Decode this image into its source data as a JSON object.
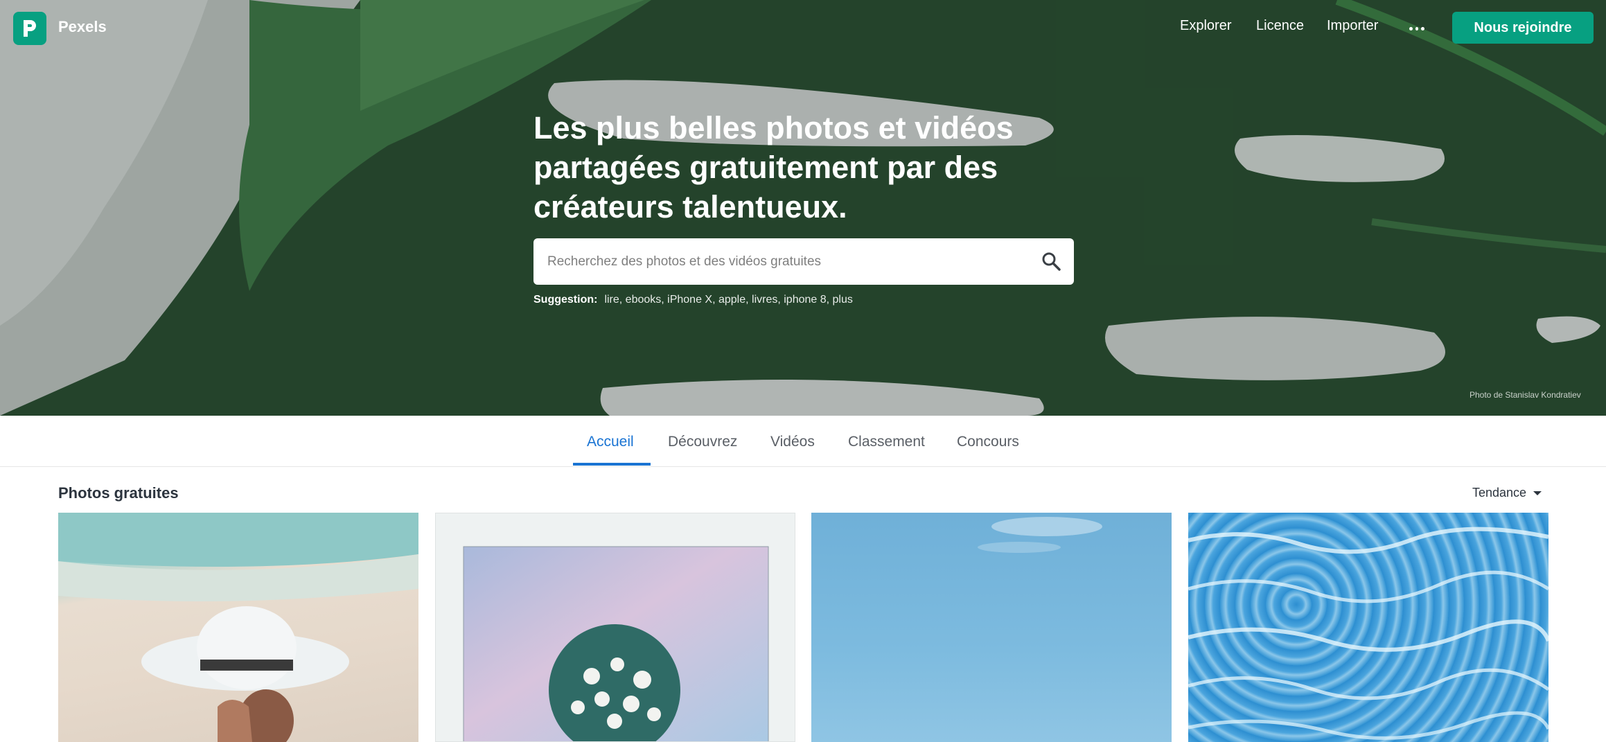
{
  "header": {
    "logo_text": "Pexels",
    "nav": [
      "Explorer",
      "Licence",
      "Importer"
    ],
    "more_icon": "ellipsis-icon",
    "join_label": "Nous rejoindre"
  },
  "hero": {
    "title": "Les plus belles photos et vidéos partagées gratuitement par des créateurs talentueux.",
    "search_placeholder": "Recherchez des photos et des vidéos gratuites",
    "search_icon": "search-icon",
    "suggestion_label": "Suggestion:",
    "suggestions": "lire, ebooks, iPhone X, apple, livres, iphone 8, plus",
    "photo_credit": "Photo de Stanislav Kondratiev"
  },
  "tabs": {
    "items": [
      "Accueil",
      "Découvrez",
      "Vidéos",
      "Classement",
      "Concours"
    ],
    "active": "Accueil"
  },
  "section": {
    "title": "Photos gratuites",
    "sort_label": "Tendance"
  },
  "colors": {
    "brand": "#07a081",
    "tab_active": "#1a74d3",
    "text": "#2c343e"
  }
}
